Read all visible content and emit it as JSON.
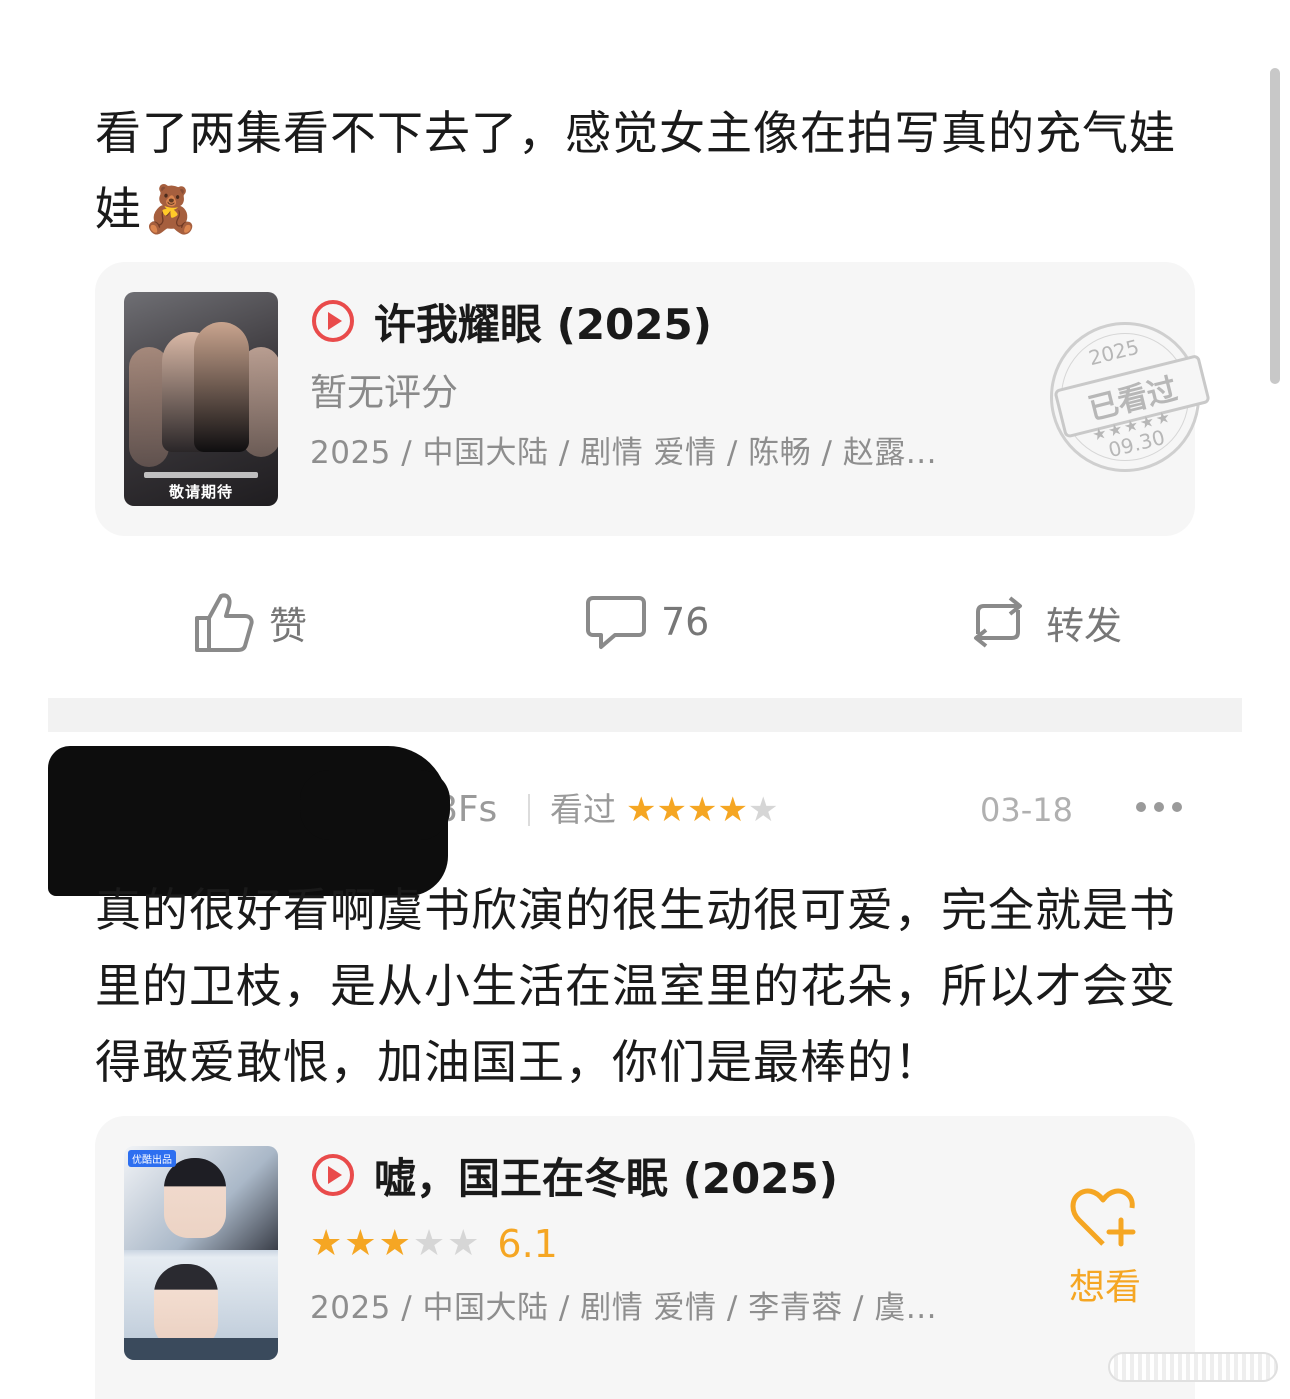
{
  "post1": {
    "text": "看了两集看不下去了，感觉女主像在拍写真的充气娃娃🧸",
    "card": {
      "title": "许我耀眼 (2025)",
      "rating_text": "暂无评分",
      "meta": "2025 / 中国大陆 / 剧情 爱情 / 陈畅 / 赵露...",
      "poster_caption": "敬请期待",
      "stamp": {
        "year": "2025",
        "label": "已看过",
        "stars": "★★★★★",
        "date": "09.30"
      }
    },
    "actions": {
      "like_label": "赞",
      "comment_count": "76",
      "share_label": "转发"
    }
  },
  "post2": {
    "username": "svg8Fs",
    "status": "看过",
    "user_rating": 4,
    "user_rating_max": 5,
    "date": "03-18",
    "text": "真的很好看啊虞书欣演的很生动很可爱，完全就是书里的卫枝，是从小生活在温室里的花朵，所以才会变得敢爱敢恨，加油国王，你们是最棒的！",
    "card": {
      "title": "嘘，国王在冬眠 (2025)",
      "stars_on": 3,
      "stars_max": 5,
      "score": "6.1",
      "meta": "2025 / 中国大陆 / 剧情 爱情 / 李青蓉 / 虞...",
      "want_label": "想看",
      "poster_tag": "优酷出品"
    }
  },
  "colors": {
    "accent": "#f5a623",
    "play_red": "#e94b4b",
    "muted": "#8e8e8e",
    "card_bg": "#f6f6f6"
  }
}
